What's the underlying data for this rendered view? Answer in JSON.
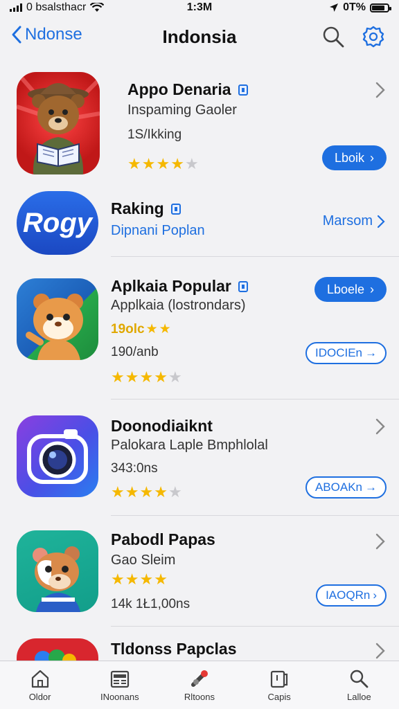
{
  "status_bar": {
    "carrier": "0 bsalsthacr",
    "time": "1:3M",
    "battery_pct": "0T%"
  },
  "nav": {
    "back_label": "Ndonse",
    "title": "Indonsia"
  },
  "apps": [
    {
      "name": "Appo Denaria",
      "subtitle": "Inspaming Gaoler",
      "meta": "1S/Ikking",
      "rating": 4,
      "action": "Lboik"
    },
    {
      "name": "Raking",
      "icon_text": "Rogy",
      "subtitle": "Dipnani Poplan",
      "action": "Marsom"
    },
    {
      "name": "Aplkaia Popular",
      "subtitle": "Applkaia (lostrondars)",
      "meta_gold": "19olc",
      "meta": "190/anb",
      "rating": 4,
      "action": "Lboele",
      "action_secondary": "IDOCIEn"
    },
    {
      "name": "Doonodiaiknt",
      "subtitle": "Palokara Laple Bmphlolal",
      "meta": "343:0ns",
      "rating": 4,
      "action_secondary": "ABOAKn"
    },
    {
      "name": "Pabodl Papas",
      "subtitle": "Gao Sleim",
      "meta": "14k 1Ł1,00ns",
      "rating": 4,
      "action_secondary": "IAOQRn"
    },
    {
      "name": "Tldonss Papclas"
    }
  ],
  "tabs": [
    {
      "label": "Oldor",
      "icon": "home-icon"
    },
    {
      "label": "INoonans",
      "icon": "news-icon"
    },
    {
      "label": "Rltoons",
      "icon": "games-icon"
    },
    {
      "label": "Capis",
      "icon": "apps-icon"
    },
    {
      "label": "Lalloe",
      "icon": "search-icon"
    }
  ],
  "colors": {
    "accent": "#1e6fe0",
    "star": "#f5b800",
    "background": "#f2f2f4"
  }
}
